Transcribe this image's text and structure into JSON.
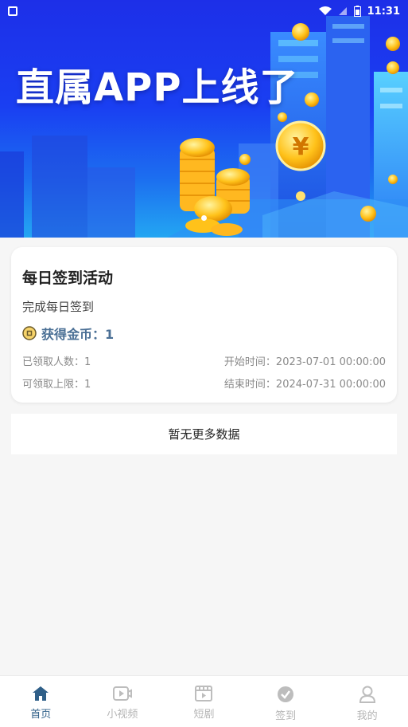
{
  "status_bar": {
    "time": "11:31"
  },
  "banner": {
    "title": "直属APP上线了"
  },
  "activity": {
    "title": "每日签到活动",
    "subtitle": "完成每日签到",
    "reward": "获得金币：1",
    "claimed_count": "已领取人数：1",
    "claim_limit": "可领取上限：1",
    "start_time": "开始时间：2023-07-01 00:00:00",
    "end_time": "结束时间：2024-07-31 00:00:00"
  },
  "list_end_text": "暂无更多数据",
  "tabbar": {
    "items": [
      {
        "label": "首页",
        "icon": "home-icon",
        "active": true
      },
      {
        "label": "小视频",
        "icon": "video-icon",
        "active": false
      },
      {
        "label": "短剧",
        "icon": "film-icon",
        "active": false
      },
      {
        "label": "签到",
        "icon": "check-circle-icon",
        "active": false
      },
      {
        "label": "我的",
        "icon": "user-icon",
        "active": false
      }
    ]
  },
  "colors": {
    "accent": "#2f5f88",
    "reward_text": "#4a6f95",
    "inactive": "#b5b5b5"
  }
}
